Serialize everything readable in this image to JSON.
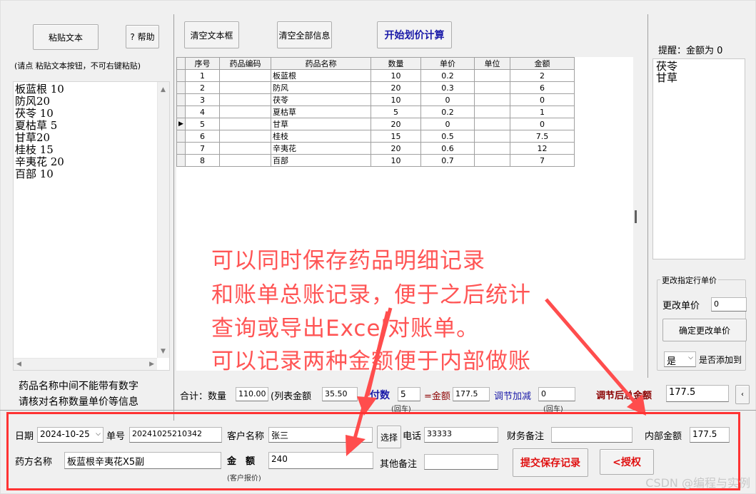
{
  "toolbar": {
    "paste_text": "粘贴文本",
    "help": "? 帮助",
    "clear_textbox": "清空文本框",
    "clear_all": "清空全部信息",
    "start_calc": "开始划价计算"
  },
  "paste_hint": "(请点 粘贴文本按钮，不可右键粘贴)",
  "paste_lines": [
    "板蓝根 10",
    "防风20",
    "茯苓 10",
    "夏枯草 5",
    "甘草20",
    "桂枝 15",
    "辛夷花 20",
    "百部 10"
  ],
  "warning": {
    "line1": "药品名称中间不能带有数字",
    "line2": "请核对名称数量单价等信息"
  },
  "grid": {
    "headers": [
      "序号",
      "药品编码",
      "药品名称",
      "数量",
      "单价",
      "单位",
      "金额"
    ],
    "current_row_marker": "▶",
    "rows": [
      [
        "1",
        "",
        "板蓝根",
        "10",
        "0.2",
        "",
        "2"
      ],
      [
        "2",
        "",
        "防风",
        "20",
        "0.3",
        "",
        "6"
      ],
      [
        "3",
        "",
        "茯苓",
        "10",
        "0",
        "",
        "0"
      ],
      [
        "4",
        "",
        "夏枯草",
        "5",
        "0.2",
        "",
        "1"
      ],
      [
        "5",
        "",
        "甘草",
        "20",
        "0",
        "",
        "0"
      ],
      [
        "6",
        "",
        "桂枝",
        "15",
        "0.5",
        "",
        "7.5"
      ],
      [
        "7",
        "",
        "辛夷花",
        "20",
        "0.6",
        "",
        "12"
      ],
      [
        "8",
        "",
        "百部",
        "10",
        "0.7",
        "",
        "7"
      ]
    ]
  },
  "reminder": {
    "label": "提醒：金额为 0 ",
    "lines": [
      "茯苓",
      "甘草"
    ]
  },
  "change_price": {
    "group_title": "更改指定行单价",
    "label": "更改单价",
    "value": "0",
    "confirm": "确定更改单价",
    "select_value": "是",
    "add_label": "是否添加到"
  },
  "totals": {
    "total_label": "合计：数量",
    "quantity": "110.00",
    "list_amount_label": "(列表金额",
    "list_amount": "35.50",
    "doses_label": "付数",
    "doses": "5",
    "doses_note": "(回车)",
    "amount_label": "=金额",
    "amount": "177.5",
    "adjust_label": "调节加减",
    "adjust": "0",
    "adjust_note": "(回车)",
    "adjusted_label": "调节后总金额",
    "adjusted": "177.5"
  },
  "form": {
    "date_label": "日期",
    "date": "2024-10-25",
    "order_label": "单号",
    "order_no": "20241025210342",
    "customer_label": "客户名称",
    "customer": "张三",
    "select_btn": "选择",
    "phone_label": "电话",
    "phone": "33333",
    "finance_note_label": "财务备注",
    "finance_note": "",
    "internal_amount_label": "内部金额",
    "internal_amount": "177.5",
    "recipe_label": "药方名称",
    "recipe": "板蓝根辛夷花X5副",
    "amount_label": "金　额",
    "amount": "240",
    "amount_note": "(客户报价)",
    "other_note_label": "其他备注",
    "other_note": "",
    "submit": "提交保存记录",
    "authorize": "<授权"
  },
  "annotation": {
    "line1": "可以同时保存药品明细记录",
    "line2": "和账单总账记录，便于之后统计",
    "line3": "查询或导出Excel对账单。",
    "line4": "可以记录两种金额便于内部做账"
  },
  "watermark": "CSDN @编程与实例",
  "colors": {
    "annotation": "#ff5555",
    "submit_text": "#e01010",
    "calc_text": "#1a1aa8",
    "adjusted_label": "#8b0000"
  }
}
